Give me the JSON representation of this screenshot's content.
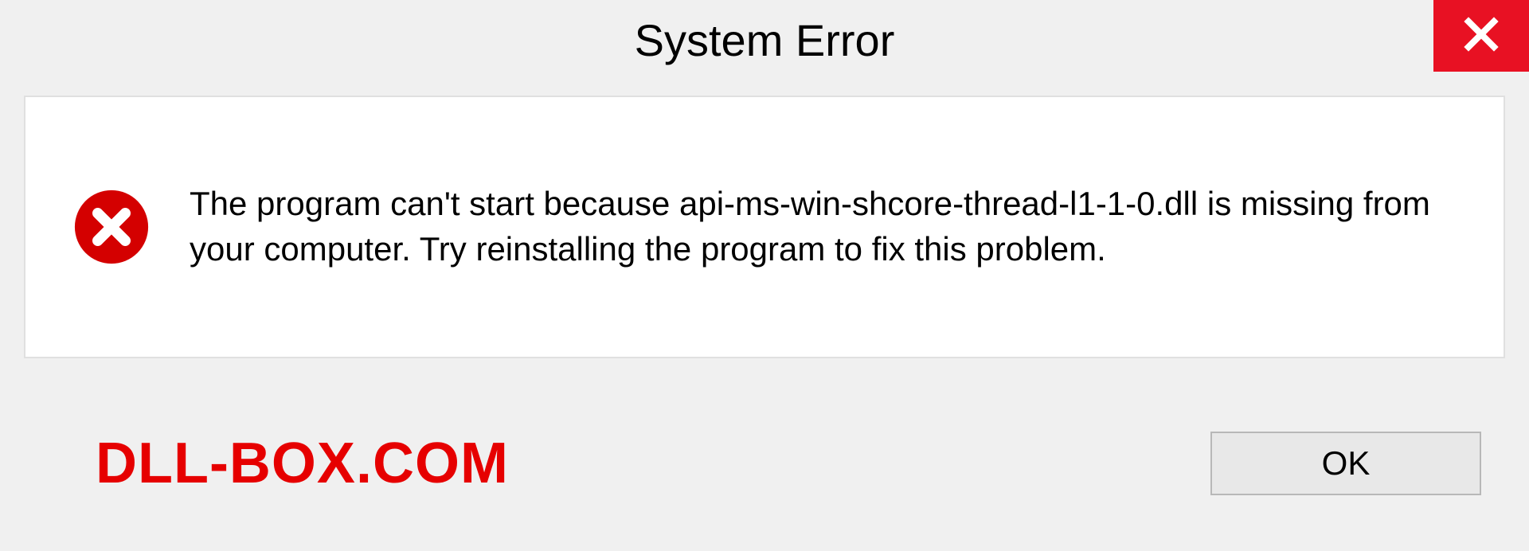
{
  "dialog": {
    "title": "System Error",
    "message": "The program can't start because api-ms-win-shcore-thread-l1-1-0.dll is missing from your computer. Try reinstalling the program to fix this problem.",
    "ok_label": "OK"
  },
  "watermark": "DLL-BOX.COM",
  "colors": {
    "close_button": "#e81123",
    "error_icon": "#d40000",
    "watermark": "#e60000"
  }
}
